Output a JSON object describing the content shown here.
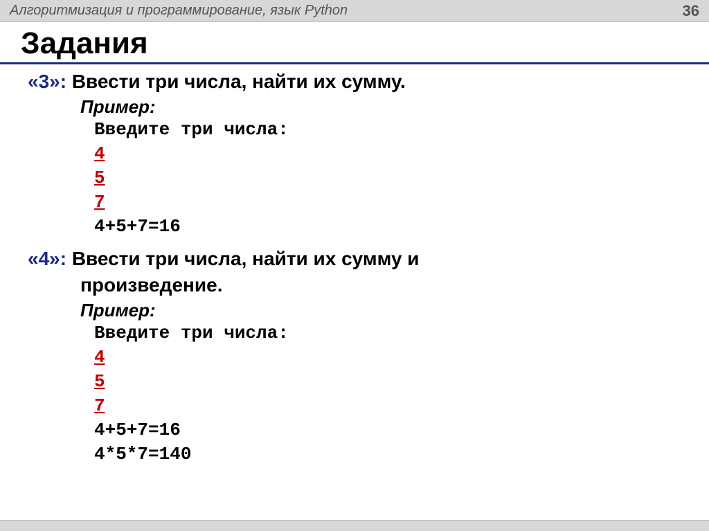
{
  "topbar": {
    "title": "Алгоритмизация и программирование, язык Python",
    "page_number": "36"
  },
  "heading": "Задания",
  "tasks": [
    {
      "grade": "«3»:",
      "text_line1": "Ввести три числа, найти их сумму.",
      "text_line2": "",
      "example_label": "Пример:",
      "code": [
        {
          "text": "Введите три числа:",
          "red": false
        },
        {
          "text": "4",
          "red": true
        },
        {
          "text": "5",
          "red": true
        },
        {
          "text": "7",
          "red": true
        },
        {
          "text": "4+5+7=16",
          "red": false
        }
      ]
    },
    {
      "grade": "«4»:",
      "text_line1": "Ввести три числа, найти их сумму и",
      "text_line2": "произведение.",
      "example_label": "Пример:",
      "code": [
        {
          "text": "Введите три числа:",
          "red": false
        },
        {
          "text": "4",
          "red": true
        },
        {
          "text": "5",
          "red": true
        },
        {
          "text": "7",
          "red": true
        },
        {
          "text": "4+5+7=16",
          "red": false
        },
        {
          "text": "4*5*7=140",
          "red": false
        }
      ]
    }
  ]
}
